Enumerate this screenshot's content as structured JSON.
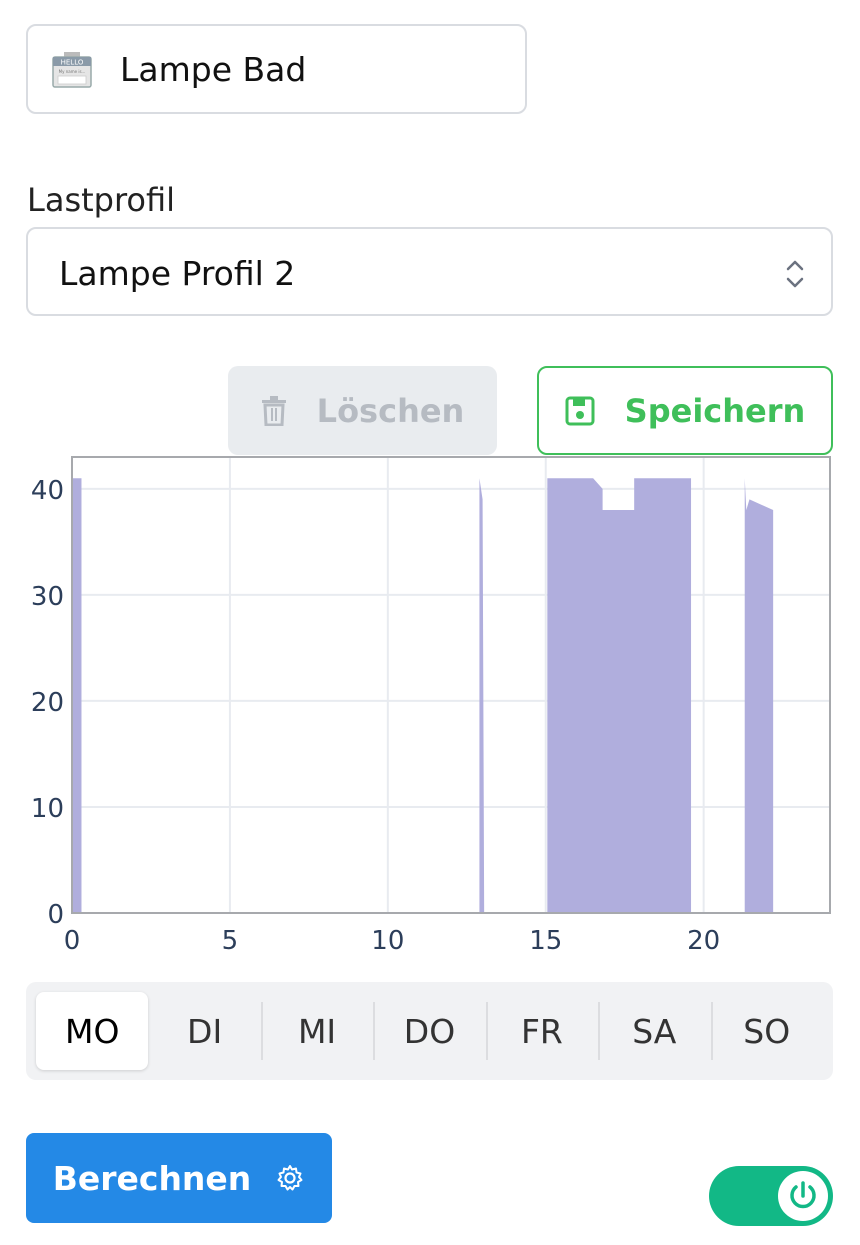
{
  "device": {
    "name": "Lampe Bad",
    "badge_icon": "name-badge-icon",
    "badge_text_top": "HELLO",
    "badge_text_bottom": "My name is..."
  },
  "profile": {
    "label": "Lastprofil",
    "selected": "Lampe Profil 2"
  },
  "actions": {
    "delete_label": "Löschen",
    "save_label": "Speichern",
    "calculate_label": "Berechnen"
  },
  "colors": {
    "accent_blue": "#2489e6",
    "save_green": "#3fbf5a",
    "toggle_green": "#12b886",
    "area_fill": "#b0aedd"
  },
  "chart_data": {
    "type": "area",
    "xlim": [
      0,
      24
    ],
    "ylim": [
      0,
      43
    ],
    "xticks": [
      0,
      5,
      10,
      15,
      20
    ],
    "yticks": [
      0,
      10,
      20,
      30,
      40
    ],
    "grid": true,
    "x": [
      0,
      0.3,
      0.3,
      12.9,
      12.9,
      13.0,
      13.05,
      13.05,
      15.05,
      15.05,
      15.2,
      16.5,
      16.8,
      16.8,
      17.8,
      17.8,
      19.6,
      19.6,
      21.3,
      21.3,
      21.35,
      21.45,
      22.2,
      22.2,
      24
    ],
    "y": [
      41,
      41,
      0,
      0,
      41,
      39,
      0,
      0,
      0,
      41,
      41,
      41,
      40,
      38,
      38,
      41,
      41,
      0,
      0,
      41,
      38,
      39,
      38,
      0,
      0
    ],
    "days": [
      "MO",
      "DI",
      "MI",
      "DO",
      "FR",
      "SA",
      "SO"
    ],
    "active_day": "MO"
  }
}
